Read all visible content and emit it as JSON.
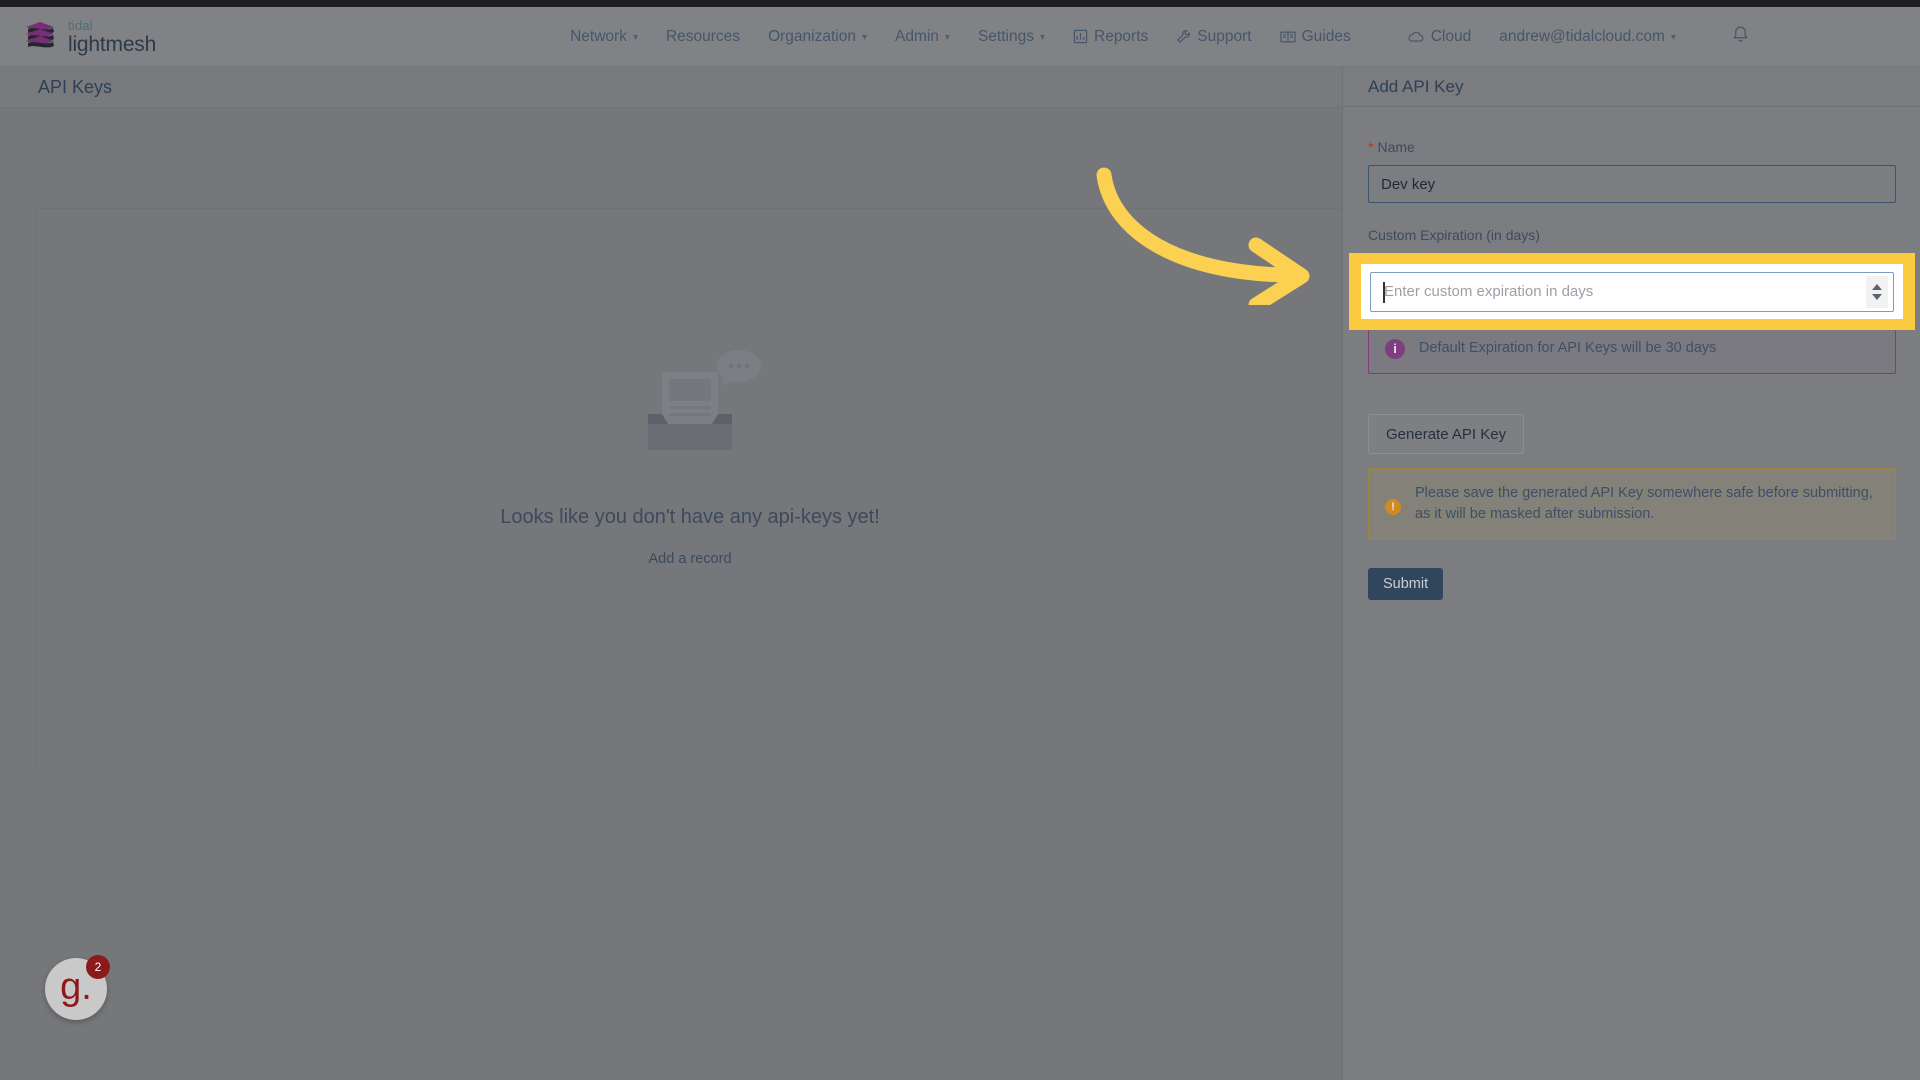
{
  "brand": {
    "top_word": "tidal",
    "bottom_word": "lightmesh",
    "logo_icon": "stacked-layers-icon"
  },
  "nav": {
    "items": [
      {
        "label": "Network",
        "has_caret": true,
        "icon": ""
      },
      {
        "label": "Resources",
        "has_caret": false,
        "icon": ""
      },
      {
        "label": "Organization",
        "has_caret": true,
        "icon": ""
      },
      {
        "label": "Admin",
        "has_caret": true,
        "icon": ""
      },
      {
        "label": "Settings",
        "has_caret": true,
        "icon": ""
      },
      {
        "label": "Reports",
        "has_caret": false,
        "icon": "bar-chart-icon"
      },
      {
        "label": "Support",
        "has_caret": false,
        "icon": "wrench-icon"
      },
      {
        "label": "Guides",
        "has_caret": false,
        "icon": "book-icon"
      },
      {
        "label": "Cloud",
        "has_caret": false,
        "icon": "cloud-icon"
      }
    ],
    "account": "andrew@tidalcloud.com",
    "notifications_icon": "bell-icon"
  },
  "page": {
    "title": "API Keys"
  },
  "empty_state": {
    "illustration": "empty-inbox-icon",
    "message": "Looks like you don't have any api-keys yet!",
    "action_label": "Add a record"
  },
  "drawer": {
    "title": "Add API Key",
    "name_label": "Name",
    "name_required_marker": "*",
    "name_value": "Dev key",
    "expiration_label": "Custom Expiration (in days)",
    "expiration_value": "",
    "expiration_placeholder": "Enter custom expiration in days",
    "info_alert": {
      "icon": "info-circle-icon",
      "text": "Default Expiration for API Keys will be 30 days"
    },
    "generate_button": "Generate API Key",
    "warning_alert": {
      "icon": "warning-circle-icon",
      "text": "Please save the generated API Key somewhere safe before submitting, as it will be masked after submission."
    },
    "submit_button": "Submit"
  },
  "widgets": {
    "g2_letter": "g.",
    "g2_count": "2"
  },
  "annotation": {
    "arrow": "curved-arrow-right",
    "highlight": "field-highlight-box"
  },
  "colors": {
    "highlight_yellow": "#fbca3e",
    "arrow_yellow": "#fcd050",
    "accent_purple": "#7d3f80",
    "accent_orange": "#cf8a21",
    "primary_button": "#31455c",
    "required_red": "#b5352f"
  }
}
